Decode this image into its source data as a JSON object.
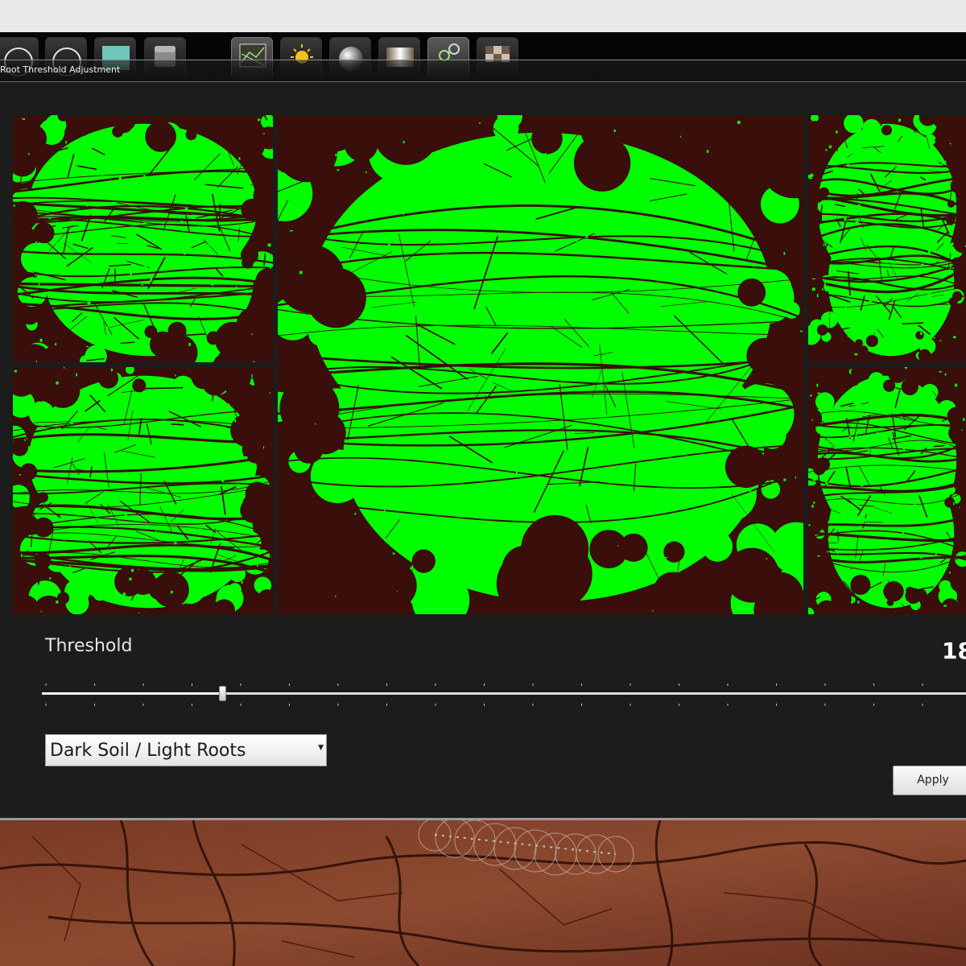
{
  "window": {
    "dialog_title": "Root Threshold Adjustment"
  },
  "toolbar": {
    "tools": [
      {
        "icon": "circle-outline-icon",
        "active": false
      },
      {
        "icon": "circle-outline-icon",
        "active": false
      },
      {
        "icon": "teal-square-icon",
        "active": false
      },
      {
        "icon": "gray-cube-icon",
        "active": false
      },
      {
        "icon": "roots-image-icon",
        "active": true
      },
      {
        "icon": "sun-brightness-icon",
        "active": false
      },
      {
        "icon": "shaded-sphere-icon",
        "active": false
      },
      {
        "icon": "gradient-icon",
        "active": false
      },
      {
        "icon": "linked-circles-icon",
        "active": true
      },
      {
        "icon": "pixel-blocks-icon",
        "active": false
      }
    ]
  },
  "previews": {
    "mask_color": "#00ff00",
    "soil_color": "#3a0e0a",
    "panels": [
      "preview-top-left",
      "preview-bottom-left",
      "preview-main",
      "preview-top-right",
      "preview-bottom-right"
    ]
  },
  "controls": {
    "threshold_label": "Threshold",
    "threshold_value": "18",
    "slider_position": 0.195,
    "mode_select": "Dark Soil / Light Roots",
    "apply_label": "Apply"
  }
}
